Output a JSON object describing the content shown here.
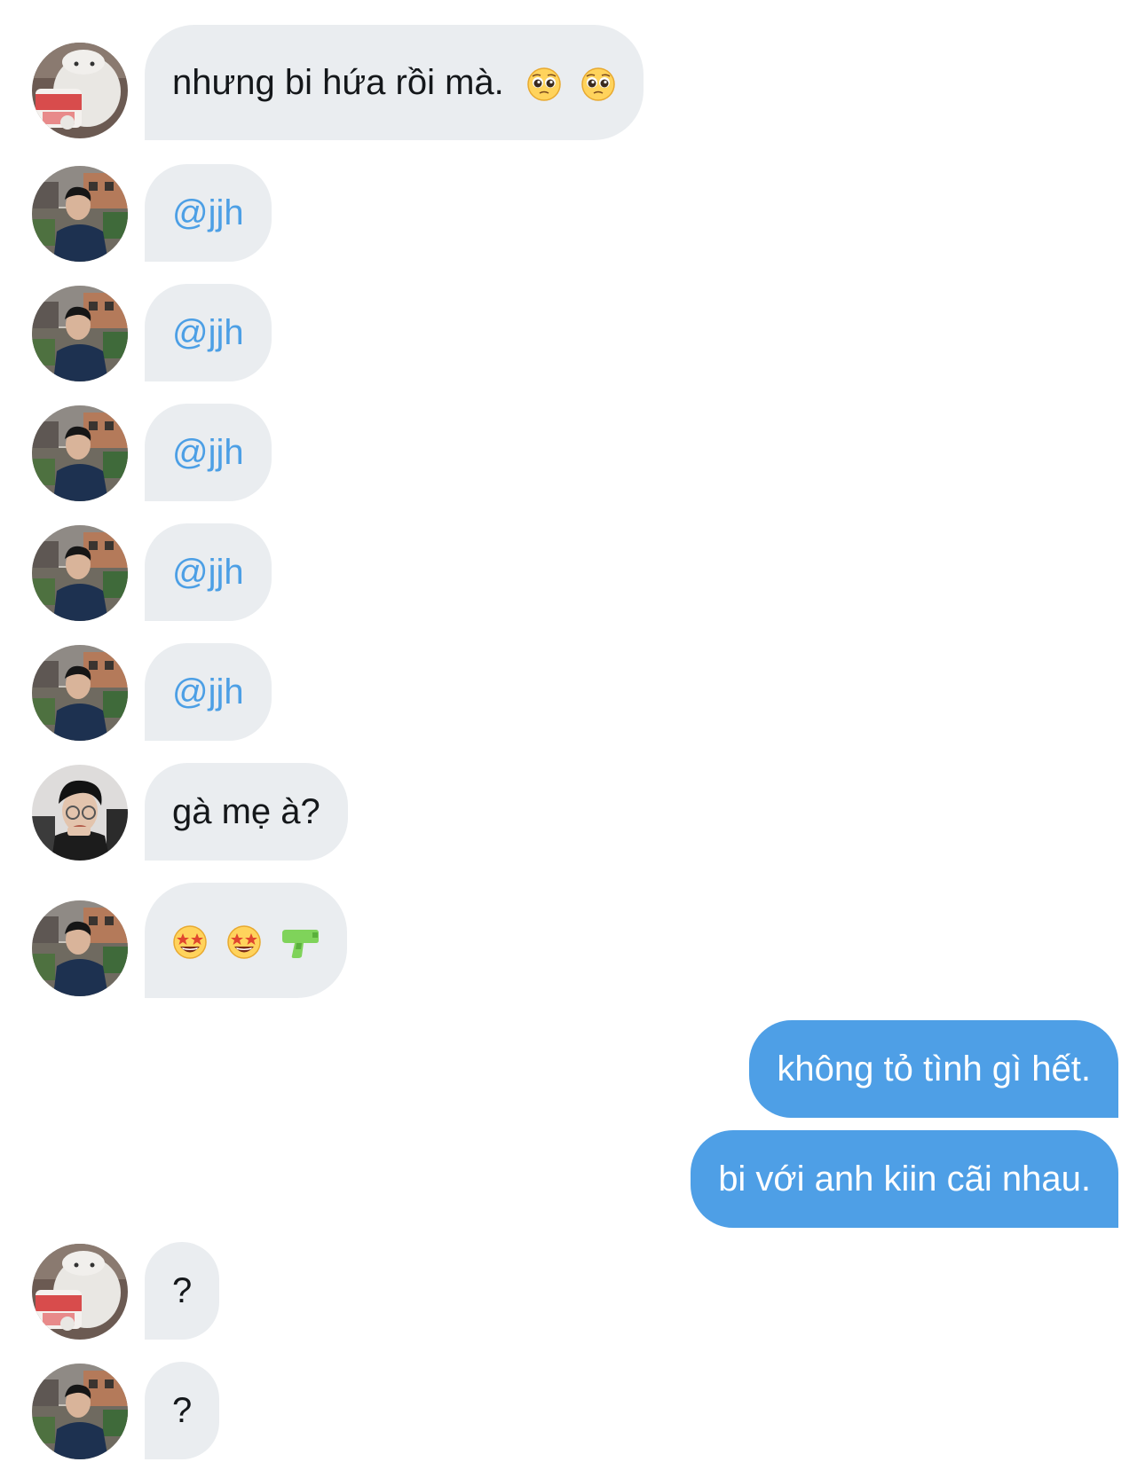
{
  "colors": {
    "received_bubble": "#eaedf0",
    "sent_bubble": "#4e9fe6",
    "mention_text": "#4c9fe5",
    "text": "#14171a"
  },
  "messages": [
    {
      "sender": "bear",
      "direction": "received",
      "text": "nhưng bi hứa rồi mà.",
      "emojis": [
        "pleading-face-emoji",
        "pleading-face-emoji"
      ]
    },
    {
      "sender": "boy-jacket",
      "direction": "received",
      "text": "@jjh"
    },
    {
      "sender": "boy-jacket",
      "direction": "received",
      "text": "@jjh"
    },
    {
      "sender": "boy-jacket",
      "direction": "received",
      "text": "@jjh"
    },
    {
      "sender": "boy-jacket",
      "direction": "received",
      "text": "@jjh"
    },
    {
      "sender": "boy-jacket",
      "direction": "received",
      "text": "@jjh"
    },
    {
      "sender": "boy-glasses",
      "direction": "received",
      "text": "gà mẹ à?"
    },
    {
      "sender": "boy-jacket",
      "direction": "received",
      "text": "",
      "emojis": [
        "star-struck-emoji",
        "star-struck-emoji",
        "water-pistol-emoji"
      ]
    },
    {
      "sender": "self",
      "direction": "sent",
      "text": "không tỏ tình gì hết."
    },
    {
      "sender": "self",
      "direction": "sent",
      "text": "bi với anh kiin cãi nhau."
    },
    {
      "sender": "bear",
      "direction": "received",
      "text": "?"
    },
    {
      "sender": "boy-jacket",
      "direction": "received",
      "text": "?"
    }
  ]
}
